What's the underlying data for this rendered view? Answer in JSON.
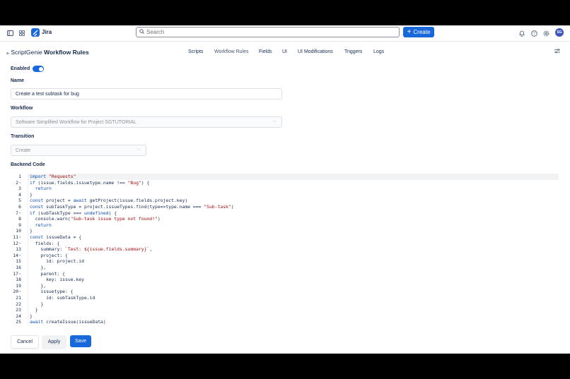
{
  "topbar": {
    "app_name": "Jira",
    "search_placeholder": "Search",
    "create_label": "Create",
    "avatar_initials": "SG"
  },
  "header": {
    "brand": "ScriptGenie",
    "title": "Workflow Rules",
    "nav": [
      "Scripts",
      "Workflow Rules",
      "Fields",
      "UI",
      "UI Modifications",
      "Triggers",
      "Logs"
    ]
  },
  "form": {
    "enabled_label": "Enabled",
    "enabled": true,
    "name_label": "Name",
    "name_value": "Create a test subtask for bug",
    "workflow_label": "Workflow",
    "workflow_value": "Software Simplified Workflow for Project SGTUTORIAL",
    "transition_label": "Transition",
    "transition_value": "Create",
    "code_label": "Backend Code"
  },
  "code": [
    "import \"Requests\"",
    "if (issue.fields.issuetype.name !== \"Bug\") {",
    "  return",
    "}",
    "const project = await getProject(issue.fields.project.key)",
    "const subTaskType = project.issueTypes.find(type=>type.name === \"Sub-task\")",
    "if (subTaskType === undefined) {",
    "  console.warn(\"Sub-task issue type not found!\")",
    "  return",
    "}",
    "const issueData = {",
    "  fields: {",
    "    summary: `Test: ${issue.fields.summary}`,",
    "    project: {",
    "      id: project.id",
    "    },",
    "    parent: {",
    "      key: issue.key",
    "    },",
    "    issuetype: {",
    "      id: subTaskType.id",
    "    }",
    "  }",
    "}",
    "await createIssue(issueData)"
  ],
  "foldable_lines": [
    2,
    7,
    11,
    12,
    14,
    17,
    20
  ],
  "footer": {
    "cancel_label": "Cancel",
    "apply_label": "Apply",
    "save_label": "Save"
  },
  "colors": {
    "accent": "#1868db",
    "text": "#172b4d",
    "keyword": "#0b4fb7",
    "string": "#a50e0e"
  }
}
